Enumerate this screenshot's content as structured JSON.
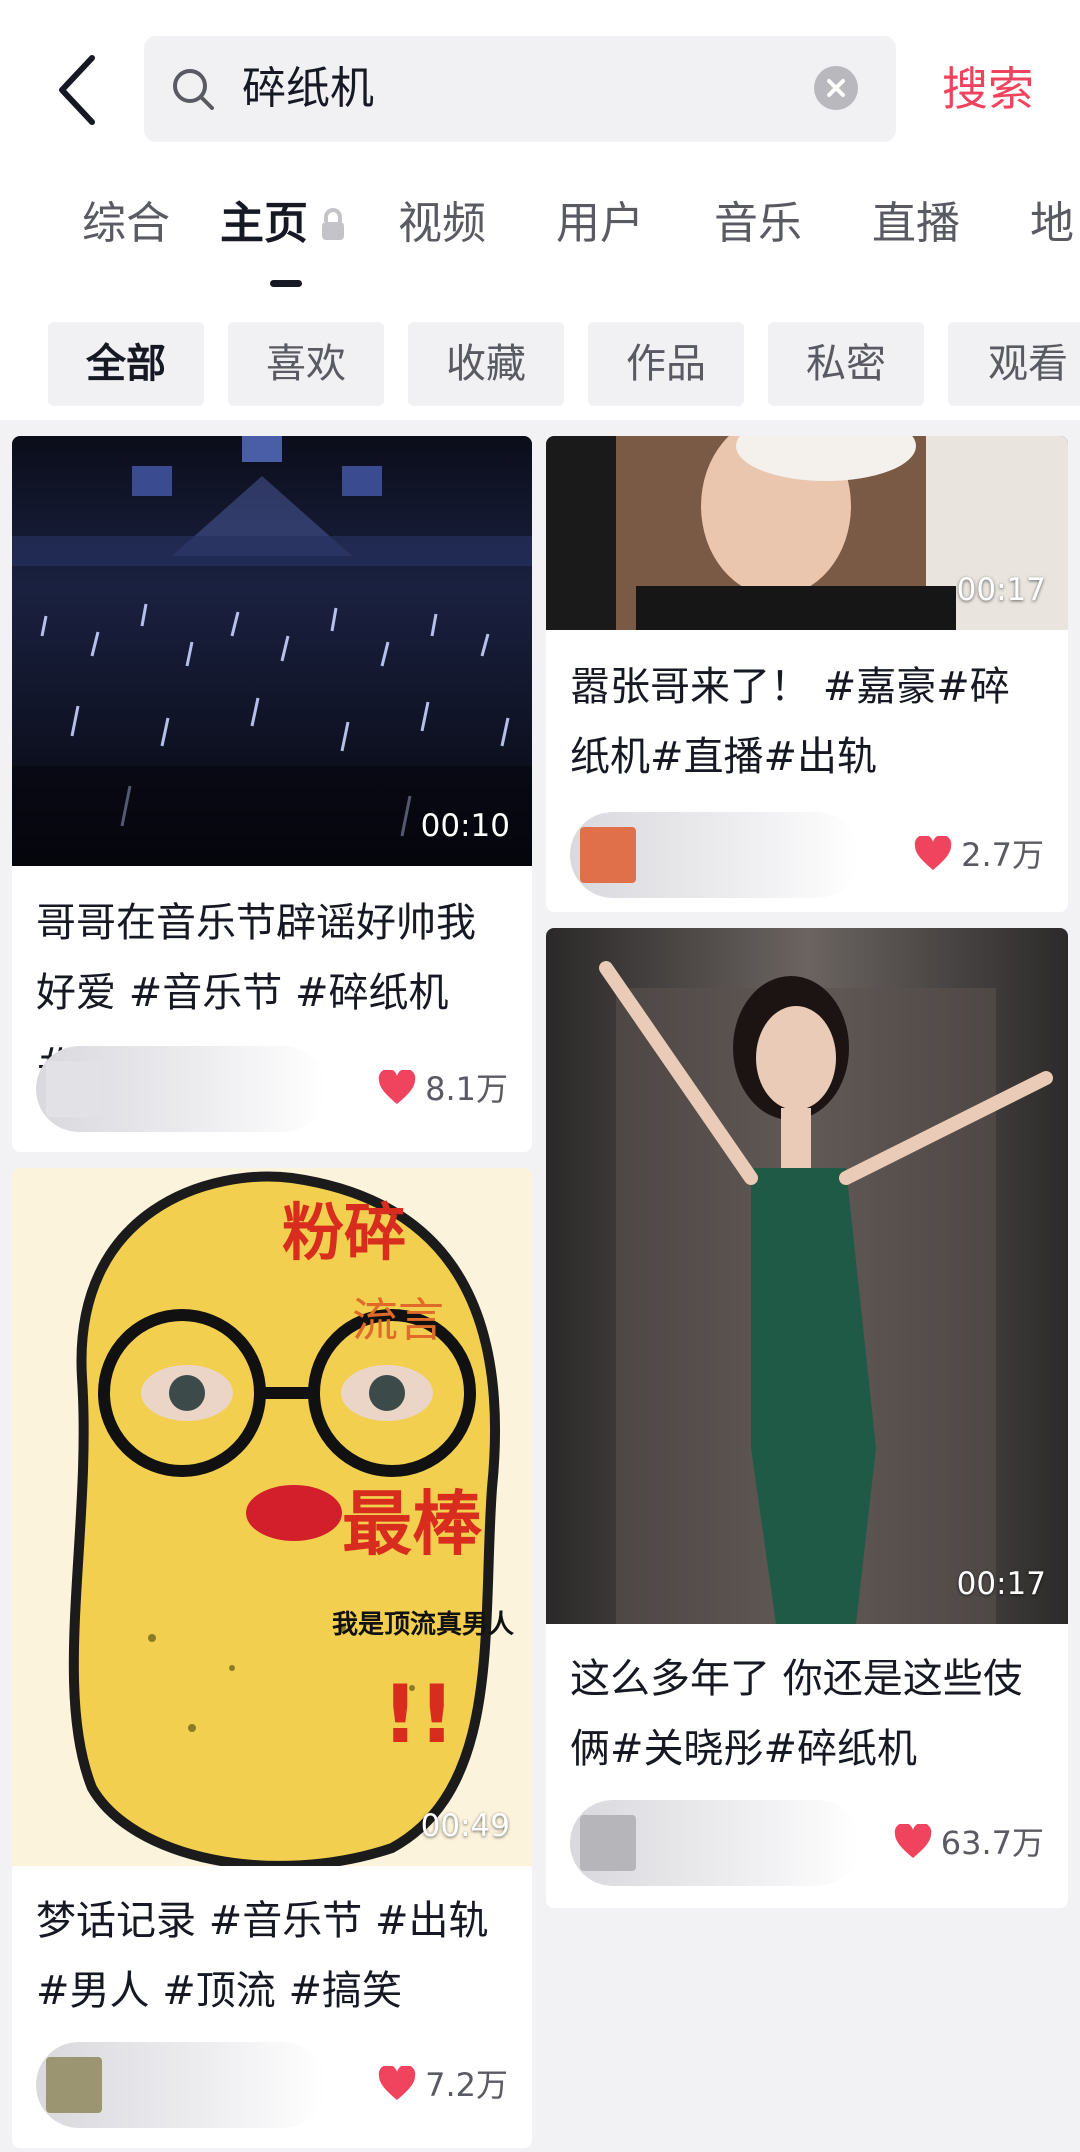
{
  "search": {
    "query": "碎纸机",
    "submit_label": "搜索"
  },
  "tabs": [
    {
      "label": "综合"
    },
    {
      "label": "主页"
    },
    {
      "label": "视频"
    },
    {
      "label": "用户"
    },
    {
      "label": "音乐"
    },
    {
      "label": "直播"
    },
    {
      "label": "地"
    }
  ],
  "chips": [
    {
      "label": "全部"
    },
    {
      "label": "喜欢"
    },
    {
      "label": "收藏"
    },
    {
      "label": "作品"
    },
    {
      "label": "私密"
    },
    {
      "label": "观看"
    }
  ],
  "cards": [
    {
      "duration": "00:10",
      "caption_line1": "哥哥在音乐节辟谣好帅我",
      "caption_line2": "好爱 #音乐节 #碎纸机 #...",
      "likes": "8.1万"
    },
    {
      "duration": "00:17",
      "caption_line1": "嚣张哥来了！ #嘉豪#碎",
      "caption_line2": "纸机#直播#出轨",
      "likes": "2.7万"
    },
    {
      "duration": "00:17",
      "caption_line1": "这么多年了 你还是这些伎",
      "caption_line2": "俩#关晓彤#碎纸机",
      "likes": "63.7万"
    },
    {
      "duration": "00:49",
      "overlay_title": "粉碎",
      "overlay_sub": "流言",
      "overlay_best": "最棒",
      "overlay_note": "我是顶流真男人",
      "overlay_exclaim": "!!",
      "caption_line1": "梦话记录 #音乐节 #出轨",
      "caption_line2": "#男人 #顶流 #搞笑",
      "likes": "7.2万"
    }
  ],
  "colors": {
    "accent": "#f0445e",
    "heart": "#f0445e",
    "background": "#f2f2f4"
  }
}
